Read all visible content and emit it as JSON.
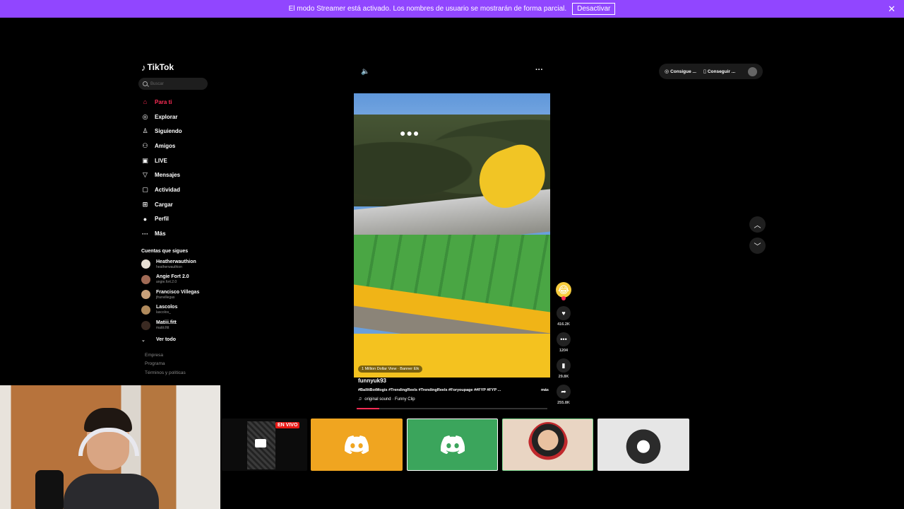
{
  "streamer_bar": {
    "message": "El modo Streamer está activado. Los nombres de usuario se mostrarán de forma parcial.",
    "button": "Desactivar",
    "close": "✕"
  },
  "sidebar": {
    "logo": "TikTok",
    "search_placeholder": "Buscar",
    "nav": [
      {
        "label": "Para ti",
        "icon": "home-icon",
        "glyph": "⌂",
        "active": true
      },
      {
        "label": "Explorar",
        "icon": "compass-icon",
        "glyph": "◎"
      },
      {
        "label": "Siguiendo",
        "icon": "following-icon",
        "glyph": "♙"
      },
      {
        "label": "Amigos",
        "icon": "friends-icon",
        "glyph": "⚇"
      },
      {
        "label": "LIVE",
        "icon": "live-icon",
        "glyph": "▣"
      },
      {
        "label": "Mensajes",
        "icon": "messages-icon",
        "glyph": "▽"
      },
      {
        "label": "Actividad",
        "icon": "activity-icon",
        "glyph": "▢"
      },
      {
        "label": "Cargar",
        "icon": "upload-icon",
        "glyph": "⊞"
      },
      {
        "label": "Perfil",
        "icon": "profile-icon",
        "glyph": "●"
      },
      {
        "label": "Más",
        "icon": "more-icon",
        "glyph": "···"
      }
    ],
    "following_title": "Cuentas que sigues",
    "accounts": [
      {
        "name": "Heatherwauthion",
        "handle": "heatherwauthion"
      },
      {
        "name": "Angie Fort 2.0",
        "handle": "angie.fort.2.0"
      },
      {
        "name": "Francisco Villegas",
        "handle": "jfranvillegas"
      },
      {
        "name": "Lascolos",
        "handle": "lascolos_"
      },
      {
        "name": "Matiii.fitt",
        "handle": "matiii.fitt"
      }
    ],
    "see_all": "Ver todo",
    "footer": [
      "Empresa",
      "Programa",
      "Términos y políticas"
    ]
  },
  "top_pill": {
    "item1": "Consigue ...",
    "item2": "Conseguir ..."
  },
  "video": {
    "tag": "1 Million Dollar View · Banner Elk",
    "username": "funnyuk93",
    "hashtags": "#BallitBotMogis #TrendingReels #TrendingReels #Foryoupage ##FYP #FYP ...",
    "more": "más",
    "sound": "original sound · Funny Clip",
    "progress": 0.12
  },
  "actions": {
    "likes": "416.2K",
    "comments": "1204",
    "saves": "29.8K",
    "shares": "255.8K"
  },
  "tiles": {
    "live_badge": "EN VIVO"
  },
  "colors": {
    "streamer_bar": "#9146ff",
    "accent": "#fe2c55",
    "discord_orange": "#f0a520",
    "discord_green": "#3ba55c"
  }
}
